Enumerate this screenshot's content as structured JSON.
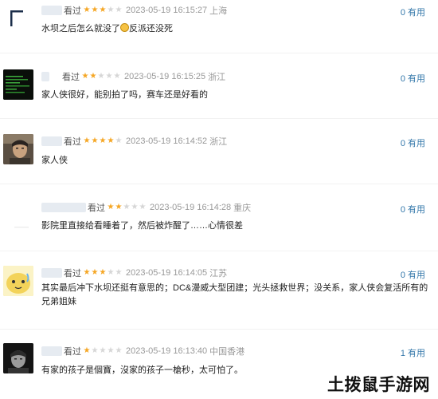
{
  "comments": [
    {
      "watched_label": "看过",
      "rating_stars": 3,
      "time": "2023-05-19 16:15:27",
      "location": "上海",
      "text_before_emoji": "水坝之后怎么就没了",
      "emoji": "smiley-face-emoji",
      "text_after_emoji": "反派还没死",
      "useful": "0 有用"
    },
    {
      "watched_label": "看过",
      "rating_stars": 2,
      "time": "2023-05-19 16:15:25",
      "location": "浙江",
      "text": "家人侠很好，能别拍了吗，赛车还是好看的",
      "useful": "0 有用"
    },
    {
      "watched_label": "看过",
      "rating_stars": 4,
      "time": "2023-05-19 16:14:52",
      "location": "浙江",
      "text": "家人侠",
      "useful": "0 有用"
    },
    {
      "watched_label": "看过",
      "rating_stars": 2,
      "time": "2023-05-19 16:14:28",
      "location": "重庆",
      "text": "影院里直接给看睡着了，然后被炸醒了……心情很差",
      "useful": "0 有用"
    },
    {
      "watched_label": "看过",
      "rating_stars": 3,
      "time": "2023-05-19 16:14:05",
      "location": "江苏",
      "text": "其实最后冲下水坝还挺有意思的；DC&漫威大型团建；光头拯救世界；没关系，家人侠会复活所有的兄弟姐妹",
      "useful": "0 有用"
    },
    {
      "watched_label": "看过",
      "rating_stars": 1,
      "time": "2023-05-19 16:13:40",
      "location": "中国香港",
      "text": "有家的孩子是個寶，沒家的孩子一槍秒，太可怕了。",
      "useful": "1 有用"
    }
  ],
  "icons": {
    "star_filled": "star-filled-icon",
    "star_empty": "star-empty-icon"
  },
  "colors": {
    "star_on": "#f5a623",
    "star_off": "#d6d6d6",
    "link_blue": "#3377aa",
    "meta_gray": "#999999"
  },
  "watermark": "土拨鼠手游网"
}
